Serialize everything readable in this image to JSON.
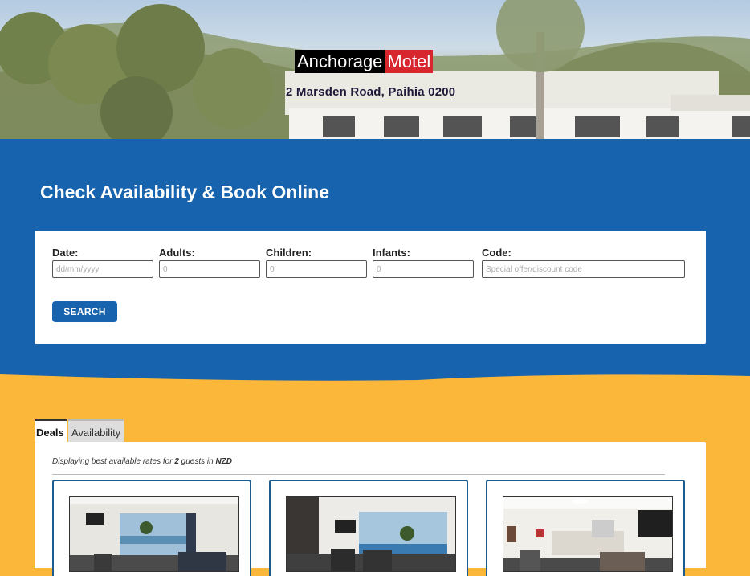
{
  "brand": {
    "name_part1": "Anchorage",
    "name_part2": "Motel",
    "address": "2 Marsden Road, Paihia 0200"
  },
  "booking": {
    "title": "Check Availability & Book Online",
    "fields": {
      "date": {
        "label": "Date:",
        "placeholder": "dd/mm/yyyy"
      },
      "adults": {
        "label": "Adults:",
        "placeholder": "0"
      },
      "children": {
        "label": "Children:",
        "placeholder": "0"
      },
      "infants": {
        "label": "Infants:",
        "placeholder": "0"
      },
      "code": {
        "label": "Code:",
        "placeholder": "Special offer/discount code"
      }
    },
    "search_label": "SEARCH"
  },
  "tabs": [
    {
      "label": "Deals",
      "active": true
    },
    {
      "label": "Availability",
      "active": false
    }
  ],
  "results": {
    "note_prefix": "Displaying best available rates for ",
    "guests": "2",
    "note_middle": " guests in ",
    "currency": "NZD"
  },
  "rooms": [
    {
      "photo": "room-photo-living-area-with-tv-and-sea-view"
    },
    {
      "photo": "room-photo-lounge-with-pool-view"
    },
    {
      "photo": "room-photo-open-plan-living-kitchen"
    }
  ],
  "colors": {
    "blue": "#1763ad",
    "yellow": "#fbb73a",
    "red": "#d8262f"
  }
}
